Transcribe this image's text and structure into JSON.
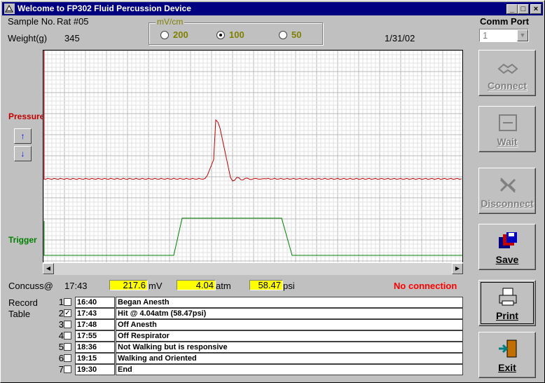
{
  "window": {
    "title": "Welcome to FP302 Fluid Percussion Device"
  },
  "info": {
    "sample_label": "Sample No.",
    "sample_value": "Rat #05",
    "weight_label": "Weight(g)",
    "weight_value": "345",
    "date": "1/31/02"
  },
  "scale": {
    "legend": "mV/cm",
    "options": [
      "200",
      "100",
      "50"
    ],
    "selected": "100"
  },
  "comm_port": {
    "label": "Comm Port",
    "value": "1"
  },
  "plot": {
    "pressure_label": "Pressure",
    "trigger_label": "Trigger",
    "pressure_color": "#c00000",
    "trigger_color": "#008000"
  },
  "chart_data": {
    "type": "line",
    "series": [
      {
        "name": "Pressure",
        "shape": "baseline with single sharp peak"
      },
      {
        "name": "Trigger",
        "shape": "rectangular pulse"
      }
    ],
    "grid": true
  },
  "buttons": {
    "connect": "Connect",
    "wait": "Wait",
    "disconnect": "Disconnect",
    "save": "Save",
    "print": "Print",
    "exit": "Exit",
    "up": "↑",
    "down": "↓"
  },
  "readout": {
    "concuss_label": "Concuss@",
    "concuss_time": "17:43",
    "mv_value": "217.6",
    "mv_unit": "mV",
    "atm_value": "4.04",
    "atm_unit": "atm",
    "psi_value": "58.47",
    "psi_unit": "psi",
    "status": "No connection"
  },
  "record_table": {
    "label1": "Record",
    "label2": "Table",
    "rows": [
      {
        "num": "1",
        "checked": false,
        "time": "16:40",
        "note": "Began Anesth"
      },
      {
        "num": "2",
        "checked": true,
        "time": "17:43",
        "note": "Hit @ 4.04atm (58.47psi)"
      },
      {
        "num": "3",
        "checked": false,
        "time": "17:48",
        "note": "Off Anesth"
      },
      {
        "num": "4",
        "checked": false,
        "time": "17:55",
        "note": "Off Respirator"
      },
      {
        "num": "5",
        "checked": false,
        "time": "18:36",
        "note": "Not Walking but is responsive"
      },
      {
        "num": "6",
        "checked": false,
        "time": "19:15",
        "note": "Walking and Oriented"
      },
      {
        "num": "7",
        "checked": false,
        "time": "19:30",
        "note": "End"
      }
    ]
  }
}
